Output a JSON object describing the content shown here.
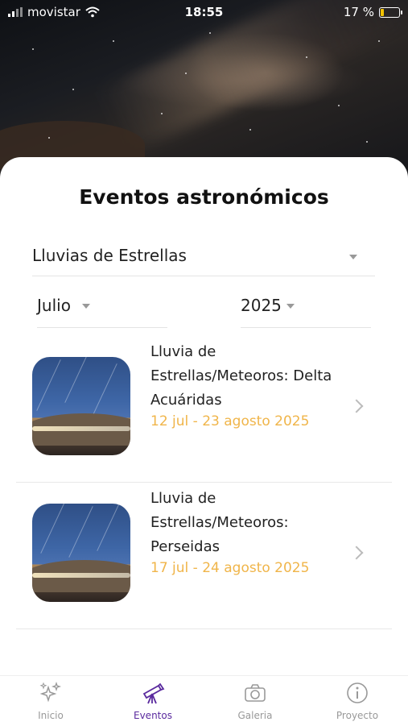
{
  "status_bar": {
    "carrier": "movistar",
    "time": "18:55",
    "battery": "17 %",
    "battery_level": 0.17
  },
  "page": {
    "title": "Eventos astronómicos"
  },
  "filters": {
    "category": "Lluvias de Estrellas",
    "month": "Julio",
    "year": "2025"
  },
  "events": [
    {
      "title": "Lluvia de Estrellas/Meteoros: Delta Acuáridas",
      "title_lines": [
        "Lluvia de",
        "Estrellas/Meteoros: Delta",
        "Acuáridas"
      ],
      "dates": "12 jul - 23 agosto 2025"
    },
    {
      "title": "Lluvia de Estrellas/Meteoros: Perseidas",
      "title_lines": [
        "Lluvia de",
        "Estrellas/Meteoros:",
        "Perseidas"
      ],
      "dates": "17 jul - 24 agosto 2025"
    }
  ],
  "tabs": [
    {
      "label": "Inicio",
      "icon": "sparkles-icon",
      "active": false
    },
    {
      "label": "Eventos",
      "icon": "telescope-icon",
      "active": true
    },
    {
      "label": "Galeria",
      "icon": "camera-icon",
      "active": false
    },
    {
      "label": "Proyecto",
      "icon": "info-icon",
      "active": false
    }
  ],
  "colors": {
    "accent": "#5a2a9e",
    "date": "#f0b54a"
  }
}
